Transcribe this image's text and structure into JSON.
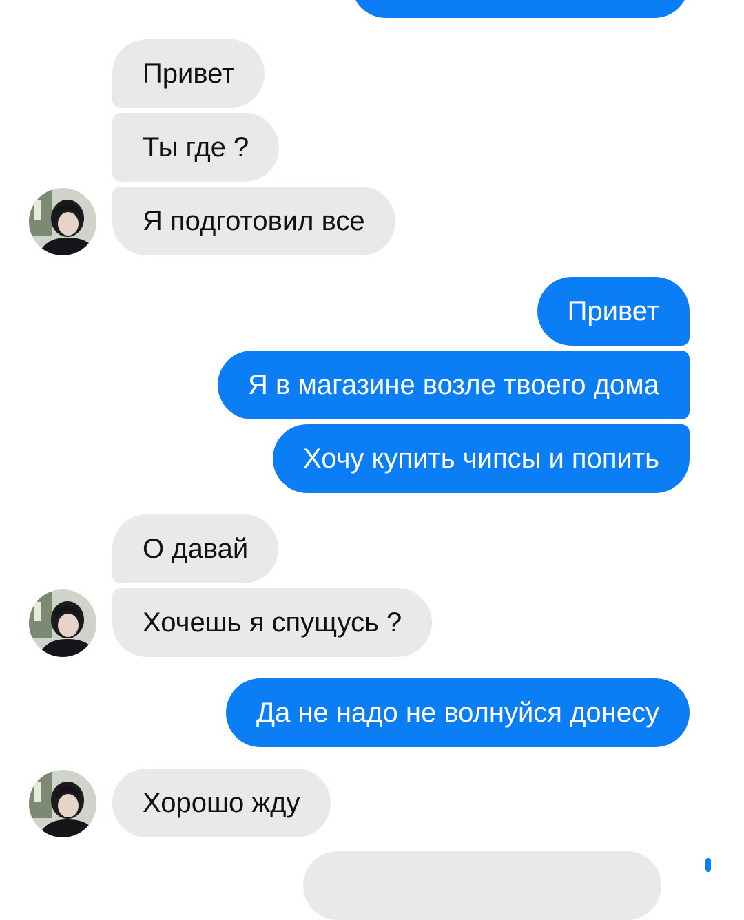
{
  "colors": {
    "outgoing_bubble": "#0b7ef5",
    "incoming_bubble": "#e9e9eb",
    "outgoing_text": "#ffffff",
    "incoming_text": "#111111",
    "background": "#ffffff"
  },
  "contact": {
    "avatar_icon": "contact-avatar-photo"
  },
  "messages": [
    {
      "side": "incoming",
      "text": "Привет"
    },
    {
      "side": "incoming",
      "text": "Ты где ?"
    },
    {
      "side": "incoming",
      "text": "Я подготовил все"
    },
    {
      "side": "outgoing",
      "text": "Привет"
    },
    {
      "side": "outgoing",
      "text": "Я в магазине возле твоего дома"
    },
    {
      "side": "outgoing",
      "text": "Хочу купить чипсы и попить"
    },
    {
      "side": "incoming",
      "text": "О давай"
    },
    {
      "side": "incoming",
      "text": "Хочешь я спущусь ?"
    },
    {
      "side": "outgoing",
      "text": "Да не надо не волнуйся донесу"
    },
    {
      "side": "incoming",
      "text": "Хорошо жду"
    }
  ]
}
